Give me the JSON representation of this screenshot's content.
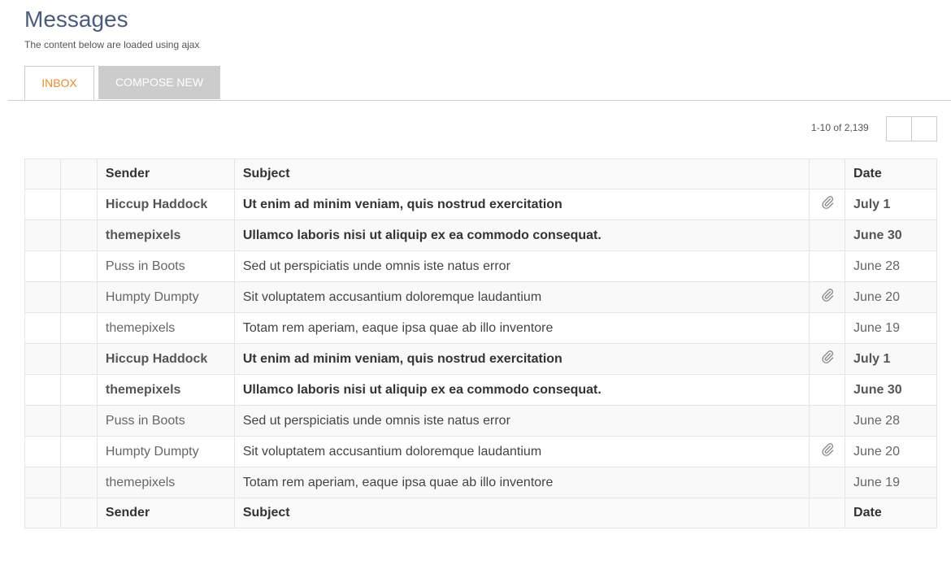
{
  "header": {
    "title": "Messages",
    "subtitle": "The content below are loaded using ajax"
  },
  "tabs": [
    {
      "label": "INBOX",
      "active": true
    },
    {
      "label": "COMPOSE NEW",
      "active": false
    }
  ],
  "pagination": {
    "text": "1-10 of 2,139"
  },
  "table": {
    "columns": [
      "",
      "",
      "Sender",
      "Subject",
      "",
      "Date"
    ],
    "rows": [
      {
        "sender": "Hiccup Haddock",
        "subject": "Ut enim ad minim veniam, quis nostrud exercitation",
        "attachment": true,
        "date": "July 1",
        "unread": true
      },
      {
        "sender": "themepixels",
        "subject": "Ullamco laboris nisi ut aliquip ex ea commodo consequat.",
        "attachment": false,
        "date": "June 30",
        "unread": true
      },
      {
        "sender": "Puss in Boots",
        "subject": "Sed ut perspiciatis unde omnis iste natus error",
        "attachment": false,
        "date": "June 28",
        "unread": false
      },
      {
        "sender": "Humpty Dumpty",
        "subject": "Sit voluptatem accusantium doloremque laudantium",
        "attachment": true,
        "date": "June 20",
        "unread": false
      },
      {
        "sender": "themepixels",
        "subject": "Totam rem aperiam, eaque ipsa quae ab illo inventore",
        "attachment": false,
        "date": "June 19",
        "unread": false
      },
      {
        "sender": "Hiccup Haddock",
        "subject": "Ut enim ad minim veniam, quis nostrud exercitation",
        "attachment": true,
        "date": "July 1",
        "unread": true
      },
      {
        "sender": "themepixels",
        "subject": "Ullamco laboris nisi ut aliquip ex ea commodo consequat.",
        "attachment": false,
        "date": "June 30",
        "unread": true
      },
      {
        "sender": "Puss in Boots",
        "subject": "Sed ut perspiciatis unde omnis iste natus error",
        "attachment": false,
        "date": "June 28",
        "unread": false
      },
      {
        "sender": "Humpty Dumpty",
        "subject": "Sit voluptatem accusantium doloremque laudantium",
        "attachment": true,
        "date": "June 20",
        "unread": false
      },
      {
        "sender": "themepixels",
        "subject": "Totam rem aperiam, eaque ipsa quae ab illo inventore",
        "attachment": false,
        "date": "June 19",
        "unread": false
      }
    ]
  },
  "icons": {
    "attachment": "paperclip-icon"
  },
  "colors": {
    "title": "#4a5c7a",
    "active_tab": "#f0872b",
    "inactive_tab_bg": "#cccccc"
  }
}
